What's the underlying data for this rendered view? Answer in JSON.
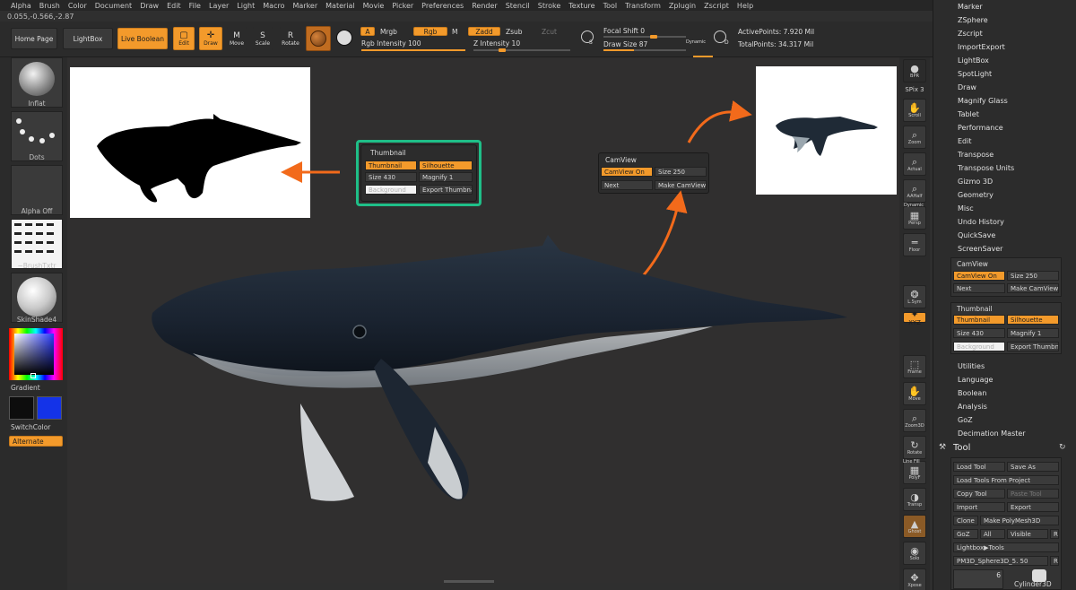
{
  "menu": [
    "Alpha",
    "Brush",
    "Color",
    "Document",
    "Draw",
    "Edit",
    "File",
    "Layer",
    "Light",
    "Macro",
    "Marker",
    "Material",
    "Movie",
    "Picker",
    "Preferences",
    "Render",
    "Stencil",
    "Stroke",
    "Texture",
    "Tool",
    "Transform",
    "Zplugin",
    "Zscript",
    "Help"
  ],
  "coords": "0.055,-0.566,-2.87",
  "topbar": {
    "home_page": "Home Page",
    "lightbox": "LightBox",
    "live_boolean": "Live Boolean",
    "edit": "Edit",
    "draw": "Draw",
    "move": "Move",
    "scale": "Scale",
    "rotate": "Rotate",
    "a_label": "A",
    "mrgb": "Mrgb",
    "rgb": "Rgb",
    "m": "M",
    "zadd": "Zadd",
    "zsub": "Zsub",
    "zcut": "Zcut",
    "rgb_intensity": "Rgb Intensity 100",
    "z_intensity": "Z Intensity 10",
    "s_label": "S",
    "d_label": "D",
    "focal_shift": "Focal Shift 0",
    "draw_size": "Draw Size 87",
    "dynamic": "Dynamic",
    "active_points": "ActivePoints: 7.920 Mil",
    "total_points": "TotalPoints: 34.317 Mil"
  },
  "left_shelf": {
    "brush": "Inflat",
    "stroke": "Dots",
    "alpha": "Alpha Off",
    "texture": "~BrushTxtr",
    "material": "SkinShade4",
    "gradient": "Gradient",
    "switch_color": "SwitchColor",
    "alternate": "Alternate",
    "colors": {
      "main": "#0d0d0d",
      "secondary": "#1433e8",
      "accent": "#f39a2b"
    }
  },
  "right_shelf": [
    {
      "name": "bpr",
      "label": "BPR",
      "icon": "sphere-icon"
    },
    {
      "name": "spix",
      "label": "SPix 3",
      "icon": "none"
    },
    {
      "name": "scroll",
      "label": "Scroll",
      "icon": "hand-icon"
    },
    {
      "name": "zoom",
      "label": "Zoom",
      "icon": "zoom-icon"
    },
    {
      "name": "actual",
      "label": "Actual",
      "icon": "zoom-icon"
    },
    {
      "name": "aahalf",
      "label": "AAHalf",
      "icon": "zoom-icon"
    },
    {
      "name": "persp",
      "label": "Persp",
      "icon": "grid-icon"
    },
    {
      "name": "floor",
      "label": "Floor",
      "icon": "floor-icon"
    },
    {
      "name": "lsym",
      "label": "L.Sym",
      "icon": "lock-icon"
    },
    {
      "name": "xyz",
      "label": "XYZ",
      "icon": "axis-icon"
    },
    {
      "name": "frame",
      "label": "Frame",
      "icon": "frame-icon"
    },
    {
      "name": "move",
      "label": "Move",
      "icon": "hand-icon"
    },
    {
      "name": "zoom3d",
      "label": "Zoom3D",
      "icon": "zoom-icon"
    },
    {
      "name": "rotate",
      "label": "Rotate",
      "icon": "rotate-icon"
    },
    {
      "name": "polyf",
      "label": "PolyF",
      "icon": "grid-icon"
    },
    {
      "name": "transp",
      "label": "Transp",
      "icon": "transp-icon"
    },
    {
      "name": "ghost",
      "label": "Ghost",
      "icon": "ghost-icon"
    },
    {
      "name": "solo",
      "label": "Solo",
      "icon": "solo-icon"
    },
    {
      "name": "xpose",
      "label": "Xpose",
      "icon": "xpose-icon"
    }
  ],
  "right_shelf_misc": {
    "dynamic": "Dynamic",
    "line_fill": "Line Fill"
  },
  "tray": {
    "items_top": [
      "Marker",
      "ZSphere",
      "Zscript",
      "ImportExport",
      "LightBox",
      "SpotLight",
      "Draw",
      "Magnify Glass",
      "Tablet",
      "Performance",
      "Edit",
      "Transpose",
      "Transpose Units",
      "Gizmo 3D",
      "Geometry",
      "Misc",
      "Undo History",
      "QuickSave",
      "ScreenSaver"
    ],
    "camview": {
      "title": "CamView",
      "on": "CamView On",
      "size": "Size 250",
      "next": "Next",
      "make": "Make CamView"
    },
    "thumbnail": {
      "title": "Thumbnail",
      "thumb": "Thumbnail",
      "silhouette": "Silhouette",
      "size": "Size 430",
      "magnify": "Magnify 1",
      "background": "Background",
      "export": "Export Thumbna"
    },
    "items_mid": [
      "Utilities",
      "Language",
      "Boolean",
      "Analysis",
      "GoZ",
      "Decimation Master"
    ],
    "tool_title": "Tool",
    "tool_buttons": [
      "Load Tool",
      "Save As",
      "Load Tools From Project",
      "Copy Tool",
      "Paste Tool",
      "Import",
      "Export",
      "Clone",
      "Make PolyMesh3D",
      "GoZ",
      "All",
      "Visible",
      "R",
      "Lightbox▶Tools",
      "PM3D_Sphere3D_5. 50",
      "R"
    ],
    "tool_thumb": {
      "count": "6",
      "name": "Cylinder3D"
    }
  },
  "canvas_popups": {
    "thumbnail": {
      "title": "Thumbnail",
      "thumb": "Thumbnail",
      "silhouette": "Silhouette",
      "size": "Size 430",
      "magnify": "Magnify 1",
      "background": "Background",
      "export": "Export Thumbna"
    },
    "camview": {
      "title": "CamView",
      "on": "CamView On",
      "size": "Size 250",
      "next": "Next",
      "make": "Make CamView"
    }
  },
  "annotations": {
    "highlight_color": "#1fbf88",
    "arrow_color": "#f26a1b"
  }
}
